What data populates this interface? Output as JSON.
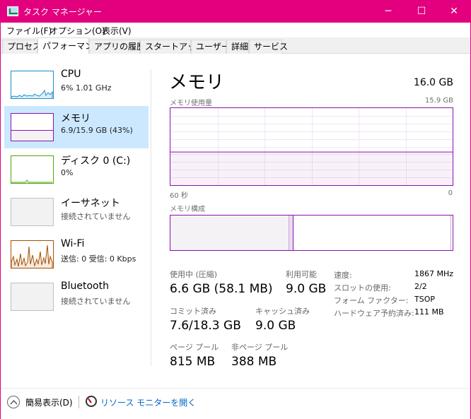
{
  "window": {
    "title": "タスク マネージャー",
    "controls": {
      "minimize": "─",
      "maximize": "☐",
      "close": "✕"
    }
  },
  "menu": [
    "ファイル(F)",
    "オプション(O)",
    "表示(V)"
  ],
  "tabs": [
    "プロセス",
    "パフォーマンス",
    "アプリの履歴",
    "スタートアップ",
    "ユーザー",
    "詳細",
    "サービス"
  ],
  "active_tab": "パフォーマンス",
  "sidebar": [
    {
      "name": "CPU",
      "sub": "6%  1.01 GHz",
      "color": "#1e8fcc"
    },
    {
      "name": "メモリ",
      "sub": "6.9/15.9 GB (43%)",
      "color": "#8b12ae"
    },
    {
      "name": "ディスク 0 (C:)",
      "sub": "0%",
      "color": "#4da60c"
    },
    {
      "name": "イーサネット",
      "sub": "接続されていません",
      "color": "#a8a8a8"
    },
    {
      "name": "Wi-Fi",
      "sub": "送信: 0 受信: 0 Kbps",
      "color": "#a74f01"
    },
    {
      "name": "Bluetooth",
      "sub": "接続されていません",
      "color": "#a8a8a8"
    }
  ],
  "main": {
    "title": "メモリ",
    "total": "16.0 GB",
    "usage_label": "メモリ使用量",
    "usage_max": "15.9 GB",
    "usage_fraction": 0.43,
    "time_left": "60 秒",
    "time_right": "0",
    "composition_label": "メモリ構成",
    "composition": {
      "in_use": 0.42,
      "modified": 0.015,
      "standby": 0.56
    },
    "stats": {
      "in_use_label": "使用中 (圧縮)",
      "in_use_value": "6.6 GB (58.1 MB)",
      "available_label": "利用可能",
      "available_value": "9.0 GB",
      "committed_label": "コミット済み",
      "committed_value": "7.6/18.3 GB",
      "cached_label": "キャッシュ済み",
      "cached_value": "9.0 GB",
      "paged_label": "ページ プール",
      "paged_value": "815 MB",
      "nonpaged_label": "非ページ プール",
      "nonpaged_value": "388 MB"
    },
    "details": [
      {
        "label": "速度:",
        "value": "1867 MHz"
      },
      {
        "label": "スロットの使用:",
        "value": "2/2"
      },
      {
        "label": "フォーム ファクター:",
        "value": "TSOP"
      },
      {
        "label": "ハードウェア予約済み:",
        "value": "111 MB"
      }
    ]
  },
  "footer": {
    "fewer_details": "簡易表示(D)",
    "resource_monitor": "リソース モニターを開く"
  }
}
